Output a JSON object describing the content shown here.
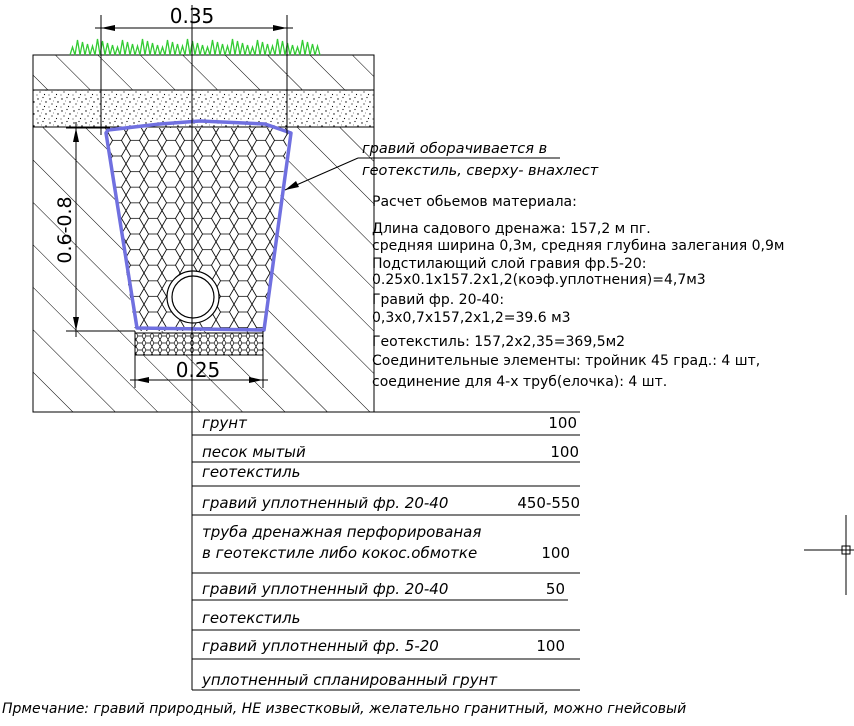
{
  "dimensions": {
    "top_width": "0.35",
    "bottom_width": "0.25",
    "depth": "0.6-0.8"
  },
  "wrap_note": {
    "line1": "гравий оборачивается в",
    "line2": "геотекстиль, сверху- внахлест"
  },
  "calc": {
    "heading": "Расчет обьемов материала:",
    "lines": [
      "Длина садового дренажа: 157,2 м пг.",
      "средняя ширина 0,3м, средняя глубина залегания 0,9м",
      "Подстилающий слой гравия фр.5-20:",
      "0.25x0.1x157.2x1,2(коэф.уплотнения)=4,7м3",
      "Гравий фр. 20-40:",
      "0,3x0,7x157,2x1,2=39.6 м3",
      "Геотекстиль: 157,2x2,35=369,5м2",
      "Соединительные элементы: тройник 45 град.: 4 шт,",
      "соединение для 4-х труб(елочка): 4 шт."
    ]
  },
  "layers": [
    {
      "name": "грунт",
      "value": "100"
    },
    {
      "name": "песок мытый",
      "value": "100"
    },
    {
      "name": "геотекстиль",
      "value": ""
    },
    {
      "name": "гравий уплотненный фр. 20-40",
      "value": "450-550"
    },
    {
      "name": "труба дренажная перфорированая",
      "name2": "в геотекстиле либо кокос.обмотке",
      "value": "100"
    },
    {
      "name": "гравий уплотненный фр. 20-40",
      "value": "50"
    },
    {
      "name": "геотекстиль",
      "value": ""
    },
    {
      "name": "гравий уплотненный фр. 5-20",
      "value": "100"
    },
    {
      "name": "уплотненный спланированный грунт",
      "value": ""
    }
  ],
  "note": "Прмечание: гравий природный, НЕ известковый, желательно гранитный, можно гнейсовый",
  "colors": {
    "outline": "#7070e0",
    "grass": "#33cc33",
    "hatch": "#000000"
  }
}
